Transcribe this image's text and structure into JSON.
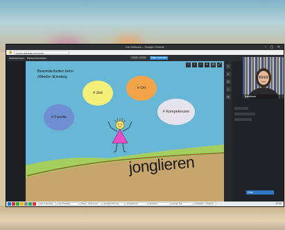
{
  "window": {
    "title": "Intr-Software – Google Chrome"
  },
  "browser": {
    "url": "zoom.intrada.com/c/m/"
  },
  "toolbar": {
    "items": [
      "Maßnahmen",
      "Bildschirmteilen"
    ],
    "time": "00:00 · 00:00",
    "share_label": "Teilen beenden"
  },
  "slide": {
    "title_line1": "Besonderheiten beim",
    "title_line2": "(Wieder-)Einstieg",
    "bubbles": {
      "zeit": {
        "label": "# Zeit",
        "color": "#f4f07a"
      },
      "ort": {
        "label": "# Ort",
        "color": "#f2a34a"
      },
      "familie": {
        "label": "# Familie",
        "color": "#6f8fd2"
      },
      "kompetenzen": {
        "label": "# Kompetenzen",
        "color": "#e6e3ec"
      }
    },
    "word": "jonglieren",
    "colors": {
      "sky": "#69b7d6",
      "grass": "#a4cf5f",
      "ground": "#c6a66c",
      "figure_dress": "#e64fc7"
    }
  },
  "video": {
    "participant_label": "Teilnehmer"
  },
  "chat": {
    "input_label": "Chat"
  },
  "taskbar": {
    "tasks": [
      "Zoom-Meeting",
      "Intr-Software",
      "Word – Dokument",
      "Google Chrome",
      "PowerPoint",
      "Explorer",
      "Neuer Tab",
      "Postfach – Outlook"
    ],
    "clock": "12:00"
  }
}
